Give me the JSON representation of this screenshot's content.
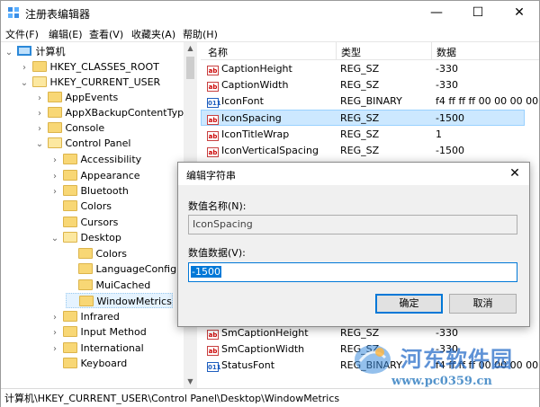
{
  "window": {
    "title": "注册表编辑器",
    "controls": {
      "minimize": "—",
      "maximize": "☐",
      "close": "✕"
    }
  },
  "menu": [
    "文件(F)",
    "编辑(E)",
    "查看(V)",
    "收藏夹(A)",
    "帮助(H)"
  ],
  "tree": {
    "root": "计算机",
    "items": [
      {
        "label": "HKEY_CLASSES_ROOT",
        "expander": "›"
      },
      {
        "label": "HKEY_CURRENT_USER",
        "expander": "⌄"
      },
      {
        "label": "AppEvents",
        "expander": "›"
      },
      {
        "label": "AppXBackupContentType",
        "expander": "›"
      },
      {
        "label": "Console",
        "expander": "›"
      },
      {
        "label": "Control Panel",
        "expander": "⌄"
      },
      {
        "label": "Accessibility",
        "expander": "›"
      },
      {
        "label": "Appearance",
        "expander": "›"
      },
      {
        "label": "Bluetooth",
        "expander": "›"
      },
      {
        "label": "Colors",
        "expander": ""
      },
      {
        "label": "Cursors",
        "expander": ""
      },
      {
        "label": "Desktop",
        "expander": "⌄"
      },
      {
        "label": "Colors",
        "expander": ""
      },
      {
        "label": "LanguageConfigu",
        "expander": ""
      },
      {
        "label": "MuiCached",
        "expander": ""
      },
      {
        "label": "WindowMetrics",
        "expander": ""
      },
      {
        "label": "Infrared",
        "expander": "›"
      },
      {
        "label": "Input Method",
        "expander": "›"
      },
      {
        "label": "International",
        "expander": "›"
      },
      {
        "label": "Keyboard",
        "expander": ""
      }
    ]
  },
  "list": {
    "columns": [
      "名称",
      "类型",
      "数据"
    ],
    "rows": [
      {
        "name": "CaptionHeight",
        "type": "REG_SZ",
        "data": "-330",
        "icon": "ab"
      },
      {
        "name": "CaptionWidth",
        "type": "REG_SZ",
        "data": "-330",
        "icon": "ab"
      },
      {
        "name": "IconFont",
        "type": "REG_BINARY",
        "data": "f4 ff ff ff 00 00 00 00",
        "icon": "011"
      },
      {
        "name": "IconSpacing",
        "type": "REG_SZ",
        "data": "-1500",
        "icon": "ab"
      },
      {
        "name": "IconTitleWrap",
        "type": "REG_SZ",
        "data": "1",
        "icon": "ab"
      },
      {
        "name": "IconVerticalSpacing",
        "type": "REG_SZ",
        "data": "-1500",
        "icon": "ab"
      },
      {
        "name": "SmCaptionHeight",
        "type": "REG_SZ",
        "data": "-330",
        "icon": "ab"
      },
      {
        "name": "SmCaptionWidth",
        "type": "REG_SZ",
        "data": "-330",
        "icon": "ab"
      },
      {
        "name": "StatusFont",
        "type": "REG_BINARY",
        "data": "f4 ff ff ff 00 00 00 00",
        "icon": "011"
      }
    ]
  },
  "statusbar": "计算机\\HKEY_CURRENT_USER\\Control Panel\\Desktop\\WindowMetrics",
  "dialog": {
    "title": "编辑字符串",
    "close": "✕",
    "name_label": "数值名称(N):",
    "name_value": "IconSpacing",
    "data_label": "数值数据(V):",
    "data_value": "-1500",
    "ok": "确定",
    "cancel": "取消"
  },
  "watermark": {
    "name": "河东软件园",
    "url": "www.pc0359.cn"
  }
}
